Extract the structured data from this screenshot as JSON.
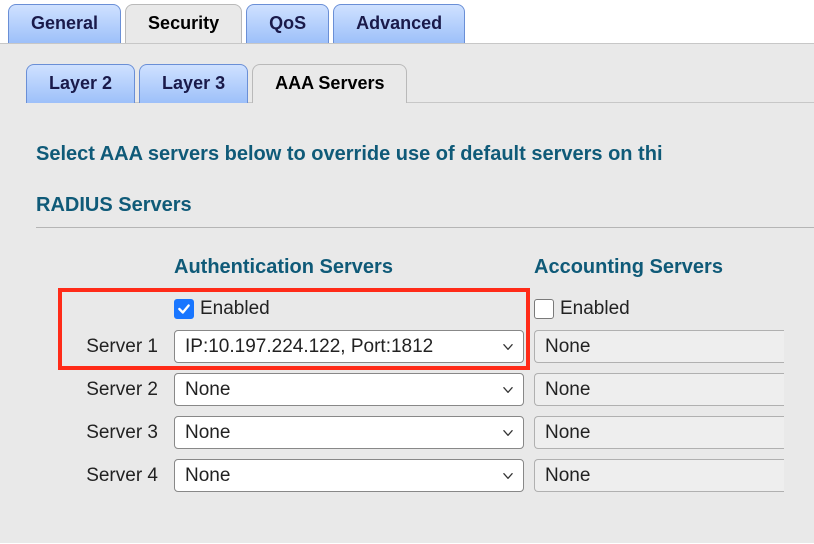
{
  "top_tabs": {
    "items": [
      "General",
      "Security",
      "QoS",
      "Advanced"
    ],
    "active_index": 1
  },
  "sub_tabs": {
    "items": [
      "Layer 2",
      "Layer 3",
      "AAA Servers"
    ],
    "active_index": 2
  },
  "intro_text": "Select AAA servers below to override use of default servers on thi",
  "section_title": "RADIUS Servers",
  "columns": {
    "auth_header": "Authentication Servers",
    "acct_header": "Accounting Servers"
  },
  "enabled_row": {
    "auth_checked": true,
    "acct_checked": false,
    "label": "Enabled"
  },
  "servers": [
    {
      "label": "Server 1",
      "auth_value": "IP:10.197.224.122, Port:1812",
      "acct_value": "None"
    },
    {
      "label": "Server 2",
      "auth_value": "None",
      "acct_value": "None"
    },
    {
      "label": "Server 3",
      "auth_value": "None",
      "acct_value": "None"
    },
    {
      "label": "Server 4",
      "auth_value": "None",
      "acct_value": "None"
    }
  ]
}
